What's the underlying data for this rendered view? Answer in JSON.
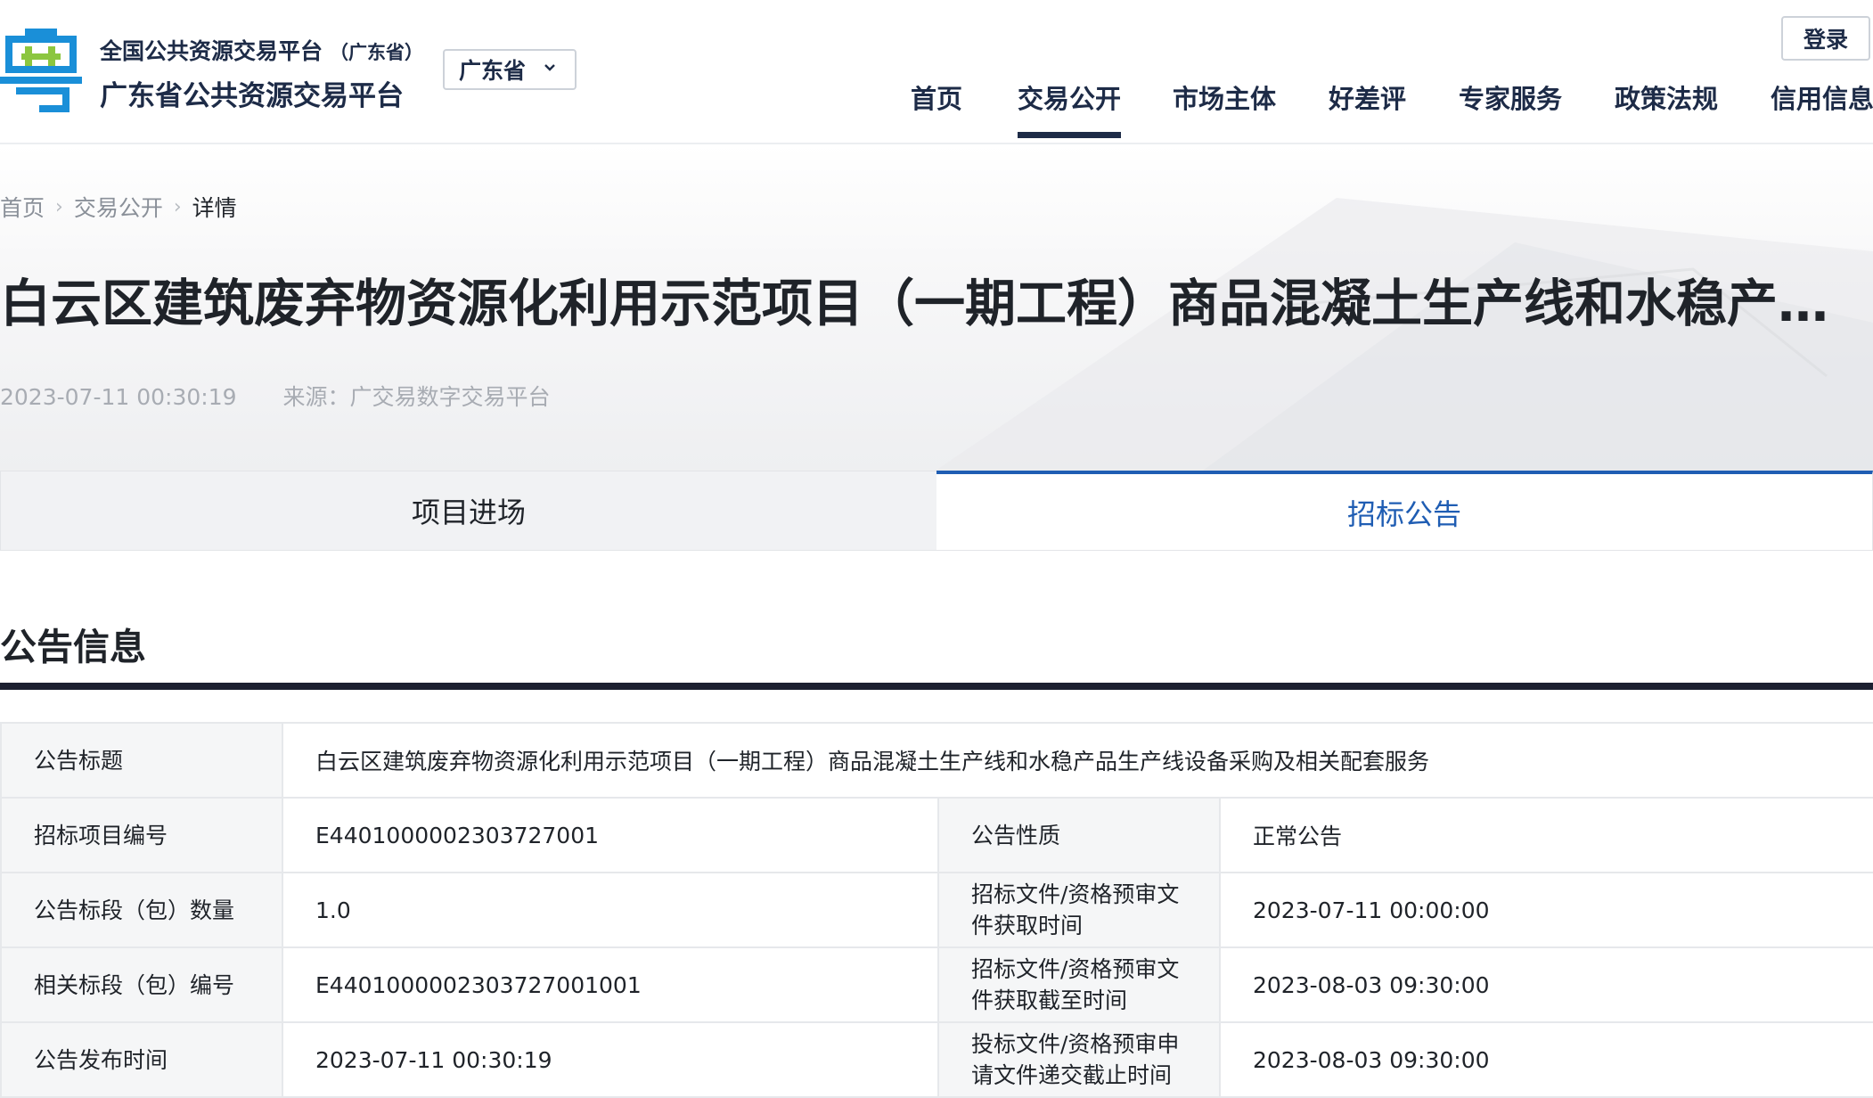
{
  "header": {
    "brand_line1": "全国公共资源交易平台",
    "brand_line1_sub": "（广东省）",
    "brand_line2": "广东省公共资源交易平台",
    "region_select": "广东省",
    "login_label": "登录",
    "nav": [
      "首页",
      "交易公开",
      "市场主体",
      "好差评",
      "专家服务",
      "政策法规",
      "信用信息"
    ],
    "active_nav": "交易公开",
    "logo_icon": "guangdong-yue-logo-icon"
  },
  "breadcrumb": {
    "home": "首页",
    "section": "交易公开",
    "current": "详情",
    "separator": "›"
  },
  "article": {
    "title": "白云区建筑废弃物资源化利用示范项目（一期工程）商品混凝土生产线和水稳产品...",
    "date": "2023-07-11 00:30:19",
    "source": "来源：广交易数字交易平台"
  },
  "tabs": [
    {
      "label": "项目进场",
      "active": false
    },
    {
      "label": "招标公告",
      "active": true
    }
  ],
  "section": {
    "title": "公告信息"
  },
  "info": {
    "title_label": "公告标题",
    "title_value": "白云区建筑废弃物资源化利用示范项目（一期工程）商品混凝土生产线和水稳产品生产线设备采购及相关配套服务",
    "rows": [
      {
        "l1": "招标项目编号",
        "v1": "E4401000002303727001",
        "l2": "公告性质",
        "v2": "正常公告"
      },
      {
        "l1": "公告标段（包）数量",
        "v1": "1.0",
        "l2": "招标文件/资格预审文件获取时间",
        "v2": "2023-07-11 00:00:00"
      },
      {
        "l1": "相关标段（包）编号",
        "v1": "E4401000002303727001001",
        "l2": "招标文件/资格预审文件获取截至时间",
        "v2": "2023-08-03 09:30:00"
      },
      {
        "l1": "公告发布时间",
        "v1": "2023-07-11 00:30:19",
        "l2": "投标文件/资格预审申请文件递交截止时间",
        "v2": "2023-08-03 09:30:00"
      }
    ]
  },
  "colors": {
    "brand_navy": "#1d2b47",
    "accent_blue": "#1f5db3",
    "logo_blue": "#1a8fd8",
    "logo_green": "#8cc63f"
  }
}
